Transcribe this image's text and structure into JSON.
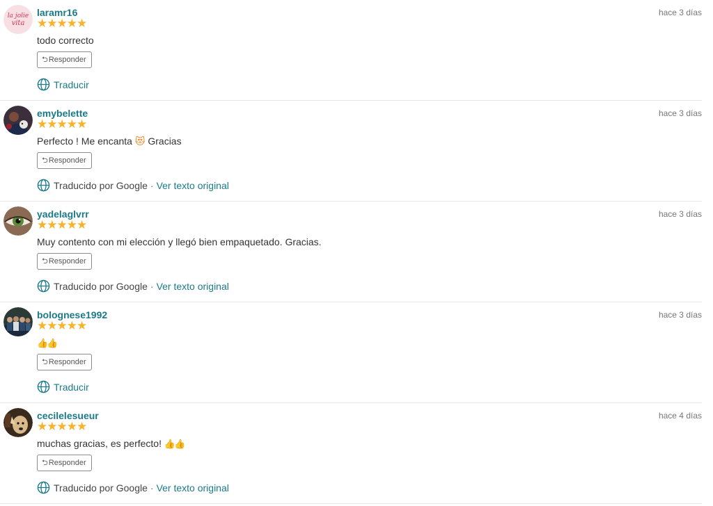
{
  "colors": {
    "link": "#1b7a8a",
    "stars": "#f7b32b",
    "border": "#e8e8e8"
  },
  "reviews": [
    {
      "username": "laramr16",
      "rating": 5,
      "stars": "★★★★★",
      "time": "hace 3 días",
      "text": "todo correcto",
      "reply_label": "Responder",
      "translate_label": "Traducir",
      "avatar_icon": "la-jolie-vita-logo-icon",
      "avatar_logo_text": "la jolie vita"
    },
    {
      "username": "emybelette",
      "rating": 5,
      "stars": "★★★★★",
      "time": "hace 3 días",
      "text": "Perfecto ! Me encanta",
      "emoji": "😻",
      "text_after": "Gracias",
      "reply_label": "Responder",
      "translated_label": "Traducido por Google",
      "separator": "·",
      "original_link": "Ver texto original",
      "avatar_icon": "user-photo-avatar"
    },
    {
      "username": "yadelaglvrr",
      "rating": 5,
      "stars": "★★★★★",
      "time": "hace 3 días",
      "text": "Muy contento con mi elección y llegó bien empaquetado. Gracias.",
      "reply_label": "Responder",
      "translated_label": "Traducido por Google",
      "separator": "·",
      "original_link": "Ver texto original",
      "avatar_icon": "eye-photo-avatar"
    },
    {
      "username": "bolognese1992",
      "rating": 5,
      "stars": "★★★★★",
      "time": "hace 3 días",
      "emoji": "👍👍",
      "reply_label": "Responder",
      "translate_label": "Traducir",
      "avatar_icon": "group-photo-avatar"
    },
    {
      "username": "cecilelesueur",
      "rating": 5,
      "stars": "★★★★★",
      "time": "hace 4 días",
      "text": "muchas gracias, es perfecto!",
      "emoji": "👍👍",
      "reply_label": "Responder",
      "translated_label": "Traducido por Google",
      "separator": "·",
      "original_link": "Ver texto original",
      "avatar_icon": "dog-photo-avatar"
    }
  ]
}
